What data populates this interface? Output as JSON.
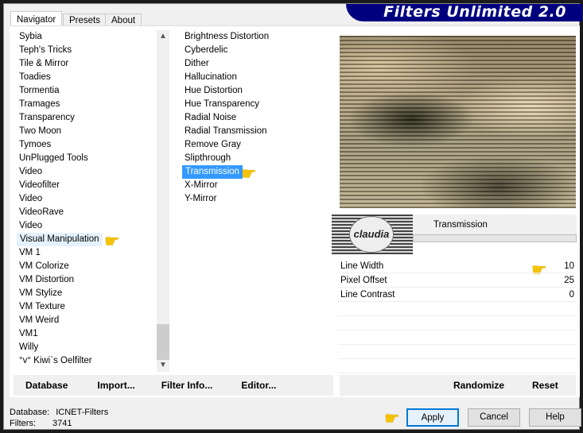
{
  "title": "Filters Unlimited 2.0",
  "tabs": [
    "Navigator",
    "Presets",
    "About"
  ],
  "categories": [
    "Sybia",
    "Teph's Tricks",
    "Tile & Mirror",
    "Toadies",
    "Tormentia",
    "Tramages",
    "Transparency",
    "Two Moon",
    "Tymoes",
    "UnPlugged Tools",
    "Video",
    "Videofilter",
    "Video",
    "VideoRave",
    "Video",
    "Visual Manipulation",
    "VM 1",
    "VM Colorize",
    "VM Distortion",
    "VM Stylize",
    "VM Texture",
    "VM Weird",
    "VM1",
    "Willy",
    "°v° Kiwi`s Oelfilter"
  ],
  "selected_category": "Visual Manipulation",
  "filters": [
    "Brightness Distortion",
    "Cyberdelic",
    "Dither",
    "Hallucination",
    "Hue Distortion",
    "Hue Transparency",
    "Radial Noise",
    "Radial Transmission",
    "Remove Gray",
    "Slipthrough",
    "Transmission",
    "X-Mirror",
    "Y-Mirror"
  ],
  "selected_filter": "Transmission",
  "filter_title": "Transmission",
  "logo_text": "claudia",
  "params": [
    {
      "label": "Line Width",
      "value": "10"
    },
    {
      "label": "Pixel Offset",
      "value": "25"
    },
    {
      "label": "Line Contrast",
      "value": "0"
    }
  ],
  "left_buttons": [
    "Database",
    "Import...",
    "Filter Info...",
    "Editor..."
  ],
  "right_buttons": [
    "Randomize",
    "Reset"
  ],
  "status": {
    "database_label": "Database:",
    "database_value": "ICNET-Filters",
    "filters_label": "Filters:",
    "filters_value": "3741"
  },
  "dialog_buttons": {
    "apply": "Apply",
    "cancel": "Cancel",
    "help": "Help"
  },
  "icons": {
    "pointer": "pointing-hand-icon"
  },
  "colors": {
    "banner": "#00007f",
    "selection": "#3399ff"
  }
}
